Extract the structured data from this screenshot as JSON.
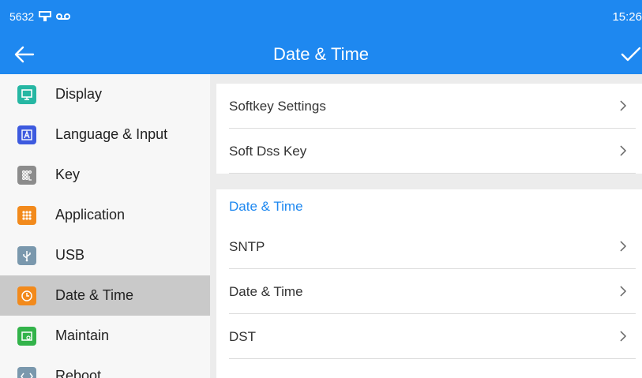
{
  "status": {
    "left_text": "5632",
    "time": "15:26"
  },
  "appbar": {
    "title": "Date & Time"
  },
  "sidebar": {
    "items": [
      {
        "label": "Display",
        "icon": "monitor-icon",
        "color": "#26b7a3"
      },
      {
        "label": "Language & Input",
        "icon": "keyboard-icon",
        "color": "#3d5adf"
      },
      {
        "label": "Key",
        "icon": "key-icon",
        "color": "#8c8c8c"
      },
      {
        "label": "Application",
        "icon": "grid-icon",
        "color": "#f28a1c"
      },
      {
        "label": "USB",
        "icon": "usb-icon",
        "color": "#7a98ad"
      },
      {
        "label": "Date & Time",
        "icon": "clock-icon",
        "color": "#f28a1c"
      },
      {
        "label": "Maintain",
        "icon": "maintain-icon",
        "color": "#33b34a"
      },
      {
        "label": "Reboot",
        "icon": "reboot-icon",
        "color": "#7a98ad"
      }
    ],
    "active_index": 5
  },
  "main": {
    "group1": [
      {
        "label": "Softkey Settings"
      },
      {
        "label": "Soft Dss Key"
      }
    ],
    "section_title": "Date & Time",
    "group2": [
      {
        "label": "SNTP"
      },
      {
        "label": "Date & Time"
      },
      {
        "label": "DST"
      }
    ]
  },
  "colors": {
    "accent": "#1e88f0",
    "active_row": "#c9c9c9"
  }
}
